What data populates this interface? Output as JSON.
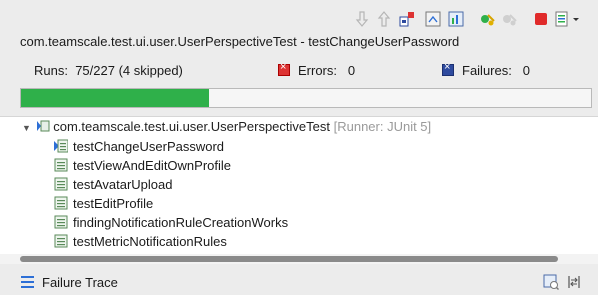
{
  "header": {
    "title": "com.teamscale.test.ui.user.UserPerspectiveTest - testChangeUserPassword"
  },
  "toolbar": {
    "icons": [
      "next-failure-icon",
      "previous-failure-icon",
      "show-failures-only-icon",
      "scroll-lock-icon",
      "show-skipped-icon",
      "rerun-test-icon",
      "rerun-failed-first-icon",
      "stop-icon",
      "test-run-history-icon",
      "view-menu-icon"
    ]
  },
  "counters": {
    "runs_label": "Runs:",
    "runs_value": "75/227 (4 skipped)",
    "errors_label": "Errors:",
    "errors_value": "0",
    "failures_label": "Failures:",
    "failures_value": "0"
  },
  "progress": {
    "completed": 75,
    "total": 227,
    "color": "#2fb04a"
  },
  "tree": {
    "root_label": "com.teamscale.test.ui.user.UserPerspectiveTest",
    "root_runner": "[Runner: JUnit 5]",
    "items": [
      {
        "label": "testChangeUserPassword",
        "status": "running"
      },
      {
        "label": "testViewAndEditOwnProfile",
        "status": "pending"
      },
      {
        "label": "testAvatarUpload",
        "status": "pending"
      },
      {
        "label": "testEditProfile",
        "status": "pending"
      },
      {
        "label": "findingNotificationRuleCreationWorks",
        "status": "pending"
      },
      {
        "label": "testMetricNotificationRules",
        "status": "pending"
      }
    ]
  },
  "failure_trace": {
    "label": "Failure Trace"
  }
}
